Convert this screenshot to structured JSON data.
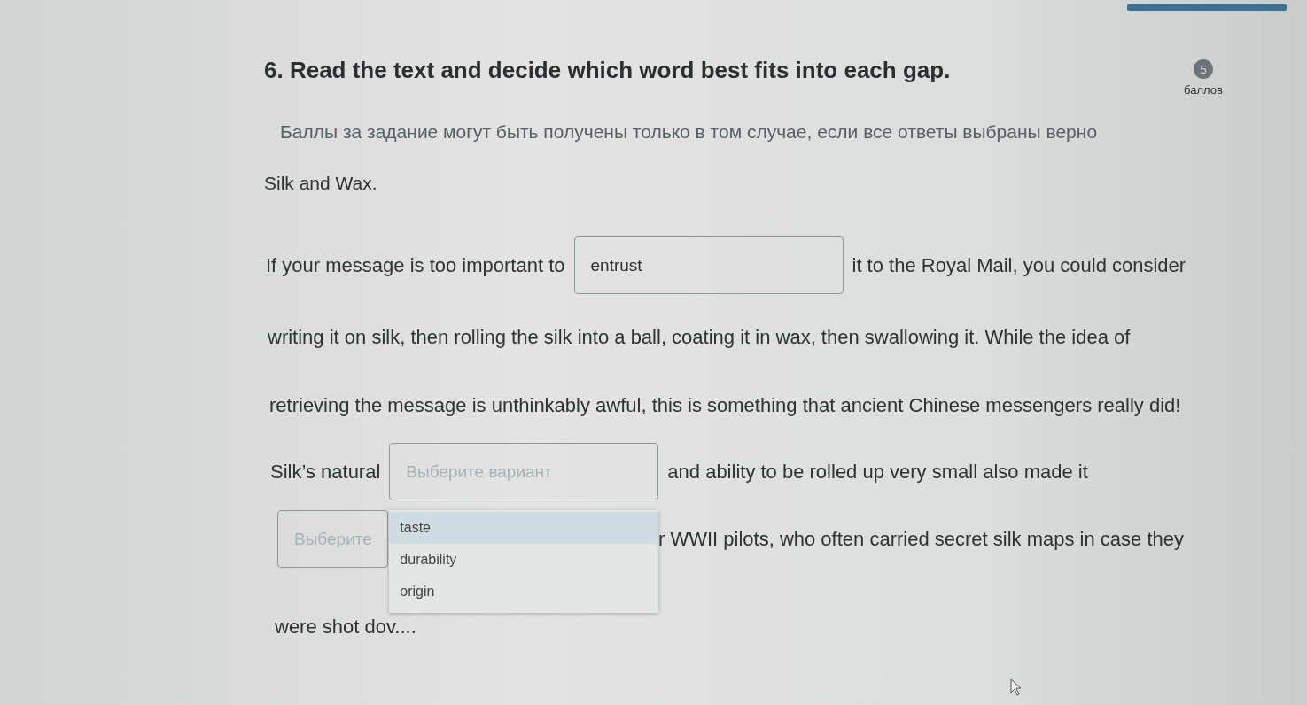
{
  "question": {
    "title": "6. Read the text and decide which word best fits into each gap.",
    "points": "5",
    "points_label": "баллов",
    "instruction": "Баллы за задание могут быть получены только в том случае, если все ответы выбраны верно"
  },
  "text_title": "Silk and Wax.",
  "lines": [
    {
      "segments": [
        {
          "kind": "text",
          "text": "If your message is too important to"
        },
        {
          "kind": "select",
          "value": "entrust"
        },
        {
          "kind": "text",
          "text": "it to the Royal Mail, you could consider"
        }
      ]
    },
    {
      "segments": [
        {
          "kind": "text",
          "text": "writing it on silk, then rolling the silk into a ball, coating it in wax, then swallowing it. While the idea of"
        }
      ]
    },
    {
      "segments": [
        {
          "kind": "text",
          "text": "retrieving the message is unthinkably awful, this is something that ancient Chinese messengers really did!"
        }
      ]
    },
    {
      "segments": [
        {
          "kind": "text",
          "text": "Silk’s natural"
        },
        {
          "kind": "select",
          "placeholder": "Выберите вариант",
          "open": true,
          "options": [
            {
              "label": "taste",
              "selected": true
            },
            {
              "label": "durability",
              "selected": false
            },
            {
              "label": "origin",
              "selected": false
            }
          ]
        },
        {
          "kind": "text",
          "text": "and ability to be rolled up very small also made it"
        }
      ]
    },
    {
      "segments": [
        {
          "kind": "select",
          "placeholder": "Выберите"
        },
        {
          "kind": "text",
          "text": "r WWII pilots, who often carried secret silk maps in case they"
        }
      ]
    },
    {
      "segments": [
        {
          "kind": "text",
          "text": "were shot dov...."
        }
      ]
    }
  ]
}
